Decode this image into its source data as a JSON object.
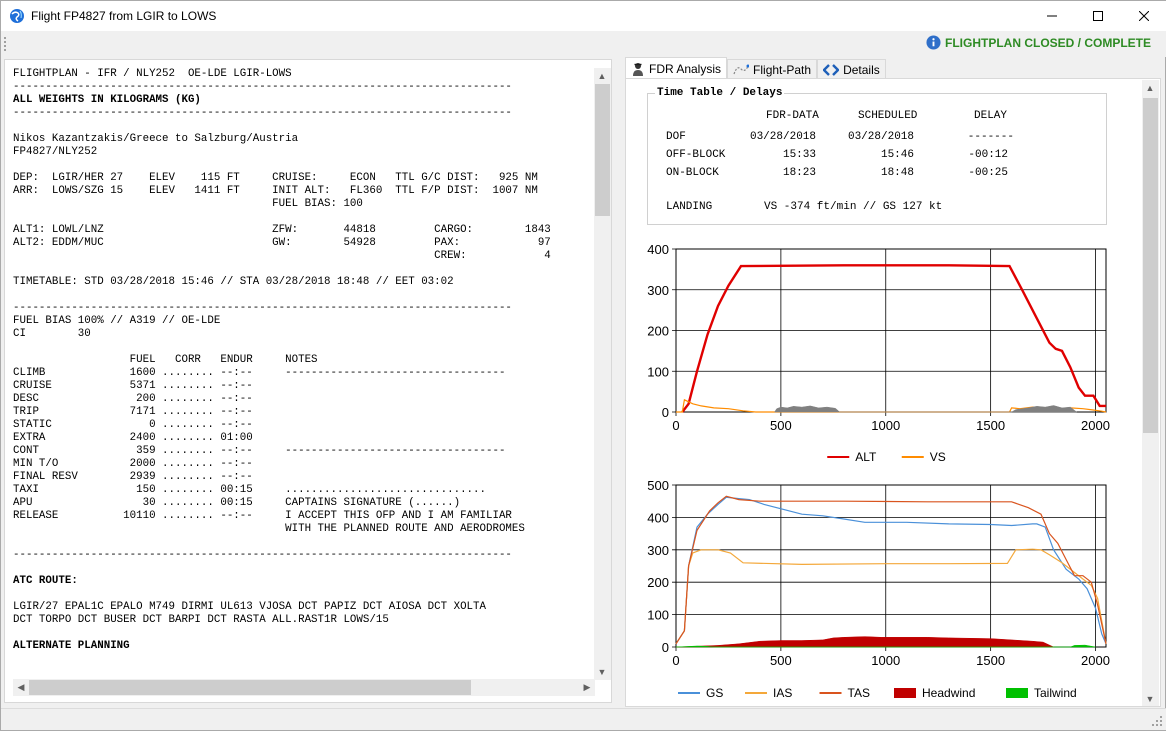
{
  "window": {
    "title": "Flight FP4827 from LGIR to LOWS",
    "status": "FLIGHTPLAN CLOSED / COMPLETE",
    "status_color": "#2e8b24",
    "icons": [
      "globe-icon",
      "minimize-icon",
      "maximize-icon",
      "close-icon",
      "info-icon"
    ]
  },
  "flightplan_text": "FLIGHTPLAN - IFR / NLY252  OE-LDE LGIR-LOWS\n-----------------------------------------------------------------------------\n~~ALL WEIGHTS IN KILOGRAMS (KG)\n-----------------------------------------------------------------------------\n\nNikos Kazantzakis/Greece to Salzburg/Austria\nFP4827/NLY252\n\nDEP:  LGIR/HER 27    ELEV    115 FT     CRUISE:     ECON   TTL G/C DIST:   925 NM\nARR:  LOWS/SZG 15    ELEV   1411 FT     INIT ALT:   FL360  TTL F/P DIST:  1007 NM\n                                        FUEL BIAS: 100\n\nALT1: LOWL/LNZ                          ZFW:       44818         CARGO:        1843\nALT2: EDDM/MUC                          GW:        54928         PAX:            97\n                                                                 CREW:            4\n\nTIMETABLE: STD 03/28/2018 15:46 // STA 03/28/2018 18:48 // EET 03:02\n\n-----------------------------------------------------------------------------\nFUEL BIAS 100% // A319 // OE-LDE\nCI        30\n\n                  FUEL   CORR   ENDUR     NOTES\nCLIMB             1600 ........ --:--     ----------------------------------\nCRUISE            5371 ........ --:--\nDESC               200 ........ --:--\nTRIP              7171 ........ --:--\nSTATIC               0 ........ --:--\nEXTRA             2400 ........ 01:00\nCONT               359 ........ --:--     ----------------------------------\nMIN T/O           2000 ........ --:--\nFINAL RESV        2939 ........ --:--\nTAXI               150 ........ 00:15     ...............................\nAPU                 30 ........ 00:15     CAPTAINS SIGNATURE (......)\nRELEASE          10110 ........ --:--     I ACCEPT THIS OFP AND I AM FAMILIAR\n                                          WITH THE PLANNED ROUTE AND AERODROMES\n\n-----------------------------------------------------------------------------\n\n~~ATC ROUTE:\n\nLGIR/27 EPAL1C EPALO M749 DIRMI UL613 VJOSA DCT PAPIZ DCT AIOSA DCT XOLTA\nDCT TORPO DCT BUSER DCT BARPI DCT RASTA ALL.RAST1R LOWS/15\n\n~~ALTERNATE PLANNING",
  "tabs": [
    {
      "label": "FDR Analysis",
      "icon": "pilot-icon",
      "active": true
    },
    {
      "label": "Flight-Path",
      "icon": "path-icon",
      "active": false
    },
    {
      "label": "Details",
      "icon": "code-icon",
      "active": false
    }
  ],
  "timetable": {
    "legend": "Time Table / Delays",
    "headers": [
      "FDR-DATA",
      "SCHEDULED",
      "DELAY"
    ],
    "rows": [
      {
        "label": "DOF",
        "fdr": "03/28/2018",
        "scheduled": "03/28/2018",
        "delay": "-------"
      },
      {
        "label": "OFF-BLOCK",
        "fdr": "15:33",
        "scheduled": "15:46",
        "delay": "-00:12"
      },
      {
        "label": "ON-BLOCK",
        "fdr": "18:23",
        "scheduled": "18:48",
        "delay": "-00:25"
      }
    ],
    "landing_label": "LANDING",
    "landing_value": "VS -374 ft/min // GS 127 kt"
  },
  "chart_data": [
    {
      "type": "line",
      "xlim": [
        0,
        2050
      ],
      "ylim": [
        0,
        400
      ],
      "x_ticks": [
        0,
        500,
        1000,
        1500,
        2000
      ],
      "y_ticks": [
        0,
        100,
        200,
        300,
        400
      ],
      "legend_position": "bottom",
      "grid": true,
      "series": [
        {
          "name": "ALT",
          "color": "#e00000",
          "style": "line",
          "points": [
            [
              30,
              0
            ],
            [
              60,
              20
            ],
            [
              100,
              100
            ],
            [
              150,
              190
            ],
            [
              200,
              260
            ],
            [
              250,
              310
            ],
            [
              310,
              358
            ],
            [
              800,
              360
            ],
            [
              1300,
              360
            ],
            [
              1590,
              358
            ],
            [
              1650,
              300
            ],
            [
              1720,
              230
            ],
            [
              1780,
              170
            ],
            [
              1810,
              155
            ],
            [
              1840,
              150
            ],
            [
              1880,
              110
            ],
            [
              1920,
              60
            ],
            [
              1950,
              40
            ],
            [
              1990,
              40
            ],
            [
              2020,
              15
            ],
            [
              2050,
              15
            ]
          ]
        },
        {
          "name": "VS",
          "color": "#ff8c00",
          "style": "line",
          "points": [
            [
              0,
              0
            ],
            [
              30,
              0
            ],
            [
              40,
              30
            ],
            [
              60,
              25
            ],
            [
              80,
              20
            ],
            [
              120,
              15
            ],
            [
              180,
              10
            ],
            [
              250,
              8
            ],
            [
              320,
              3
            ],
            [
              380,
              0
            ],
            [
              1590,
              0
            ],
            [
              1600,
              10
            ],
            [
              1640,
              8
            ],
            [
              1700,
              12
            ],
            [
              1760,
              10
            ],
            [
              1820,
              6
            ],
            [
              1880,
              10
            ],
            [
              1940,
              8
            ],
            [
              1990,
              5
            ],
            [
              2030,
              2
            ],
            [
              2050,
              0
            ]
          ]
        },
        {
          "name": "",
          "color": "#808080",
          "style": "area",
          "points": [
            [
              470,
              0
            ],
            [
              480,
              8
            ],
            [
              500,
              12
            ],
            [
              530,
              10
            ],
            [
              560,
              14
            ],
            [
              600,
              12
            ],
            [
              640,
              15
            ],
            [
              680,
              10
            ],
            [
              720,
              12
            ],
            [
              760,
              9
            ],
            [
              780,
              0
            ],
            [
              1600,
              0
            ],
            [
              1620,
              6
            ],
            [
              1680,
              10
            ],
            [
              1720,
              14
            ],
            [
              1760,
              12
            ],
            [
              1800,
              16
            ],
            [
              1840,
              10
            ],
            [
              1880,
              12
            ],
            [
              1910,
              0
            ]
          ]
        }
      ]
    },
    {
      "type": "line",
      "xlim": [
        0,
        2050
      ],
      "ylim": [
        0,
        500
      ],
      "x_ticks": [
        0,
        500,
        1000,
        1500,
        2000
      ],
      "y_ticks": [
        0,
        100,
        200,
        300,
        400,
        500
      ],
      "legend_position": "bottom",
      "grid": true,
      "series": [
        {
          "name": "GS",
          "color": "#4a90d9",
          "style": "line",
          "points": [
            [
              0,
              10
            ],
            [
              40,
              50
            ],
            [
              60,
              250
            ],
            [
              100,
              370
            ],
            [
              150,
              410
            ],
            [
              200,
              440
            ],
            [
              240,
              462
            ],
            [
              300,
              458
            ],
            [
              350,
              455
            ],
            [
              420,
              440
            ],
            [
              600,
              410
            ],
            [
              700,
              405
            ],
            [
              800,
              395
            ],
            [
              900,
              385
            ],
            [
              1100,
              385
            ],
            [
              1300,
              380
            ],
            [
              1500,
              378
            ],
            [
              1600,
              375
            ],
            [
              1700,
              380
            ],
            [
              1720,
              380
            ],
            [
              1760,
              370
            ],
            [
              1800,
              300
            ],
            [
              1860,
              240
            ],
            [
              1920,
              210
            ],
            [
              1960,
              180
            ],
            [
              2000,
              120
            ],
            [
              2030,
              40
            ],
            [
              2050,
              10
            ]
          ]
        },
        {
          "name": "IAS",
          "color": "#f4a83a",
          "style": "line",
          "points": [
            [
              0,
              10
            ],
            [
              40,
              50
            ],
            [
              60,
              250
            ],
            [
              80,
              290
            ],
            [
              120,
              300
            ],
            [
              200,
              300
            ],
            [
              260,
              290
            ],
            [
              320,
              260
            ],
            [
              600,
              255
            ],
            [
              1000,
              257
            ],
            [
              1300,
              257
            ],
            [
              1580,
              258
            ],
            [
              1620,
              300
            ],
            [
              1700,
              302
            ],
            [
              1740,
              300
            ],
            [
              1780,
              285
            ],
            [
              1840,
              260
            ],
            [
              1900,
              230
            ],
            [
              1940,
              210
            ],
            [
              1980,
              190
            ],
            [
              2010,
              150
            ],
            [
              2050,
              10
            ]
          ]
        },
        {
          "name": "TAS",
          "color": "#d9541e",
          "style": "line",
          "points": [
            [
              0,
              10
            ],
            [
              40,
              50
            ],
            [
              60,
              250
            ],
            [
              100,
              360
            ],
            [
              160,
              420
            ],
            [
              200,
              445
            ],
            [
              240,
              465
            ],
            [
              300,
              455
            ],
            [
              400,
              450
            ],
            [
              800,
              450
            ],
            [
              1200,
              448
            ],
            [
              1550,
              448
            ],
            [
              1600,
              448
            ],
            [
              1680,
              430
            ],
            [
              1740,
              410
            ],
            [
              1780,
              350
            ],
            [
              1820,
              320
            ],
            [
              1860,
              270
            ],
            [
              1900,
              220
            ],
            [
              1940,
              220
            ],
            [
              1980,
              200
            ],
            [
              2010,
              130
            ],
            [
              2050,
              10
            ]
          ]
        },
        {
          "name": "Headwind",
          "color": "#c00000",
          "style": "area",
          "points": [
            [
              0,
              0
            ],
            [
              200,
              5
            ],
            [
              300,
              10
            ],
            [
              400,
              18
            ],
            [
              500,
              20
            ],
            [
              600,
              20
            ],
            [
              700,
              22
            ],
            [
              750,
              28
            ],
            [
              800,
              30
            ],
            [
              900,
              32
            ],
            [
              980,
              30
            ],
            [
              1000,
              30
            ],
            [
              1200,
              30
            ],
            [
              1300,
              28
            ],
            [
              1500,
              26
            ],
            [
              1600,
              22
            ],
            [
              1700,
              18
            ],
            [
              1750,
              15
            ],
            [
              1800,
              0
            ]
          ]
        },
        {
          "name": "Tailwind",
          "color": "#00c000",
          "style": "area",
          "points": [
            [
              0,
              0
            ],
            [
              100,
              3
            ],
            [
              150,
              2
            ],
            [
              180,
              0
            ],
            [
              1880,
              0
            ],
            [
              1900,
              5
            ],
            [
              1950,
              6
            ],
            [
              2000,
              0
            ]
          ]
        }
      ]
    }
  ]
}
